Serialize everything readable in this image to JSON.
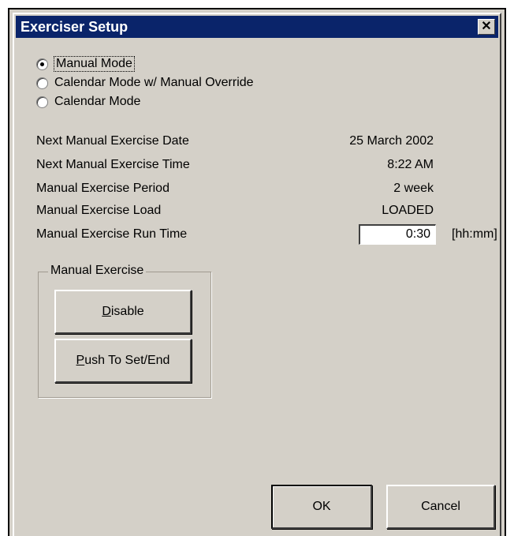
{
  "window": {
    "title": "Exerciser Setup",
    "close_glyph": "✕"
  },
  "modes": [
    {
      "label": "Manual Mode",
      "checked": true
    },
    {
      "label": "Calendar Mode w/ Manual Override",
      "checked": false
    },
    {
      "label": "Calendar Mode",
      "checked": false
    }
  ],
  "info": {
    "next_date_label": "Next Manual Exercise Date",
    "next_date_value": "25 March 2002",
    "next_time_label": "Next Manual Exercise Time",
    "next_time_value": "8:22 AM",
    "period_label": "Manual Exercise Period",
    "period_value": "2 week",
    "load_label": "Manual Exercise Load",
    "load_value": "LOADED",
    "run_time_label": "Manual Exercise Run Time",
    "run_time_value": "0:30",
    "run_time_unit": "[hh:mm]"
  },
  "manual_exercise": {
    "group_label": "Manual Exercise",
    "disable_mnemonic": "D",
    "disable_rest": "isable",
    "push_mnemonic": "P",
    "push_rest": "ush To Set/End"
  },
  "footer": {
    "ok_label": "OK",
    "cancel_label": "Cancel"
  },
  "colors": {
    "titlebar": "#0a246a",
    "face": "#d4d0c8"
  }
}
